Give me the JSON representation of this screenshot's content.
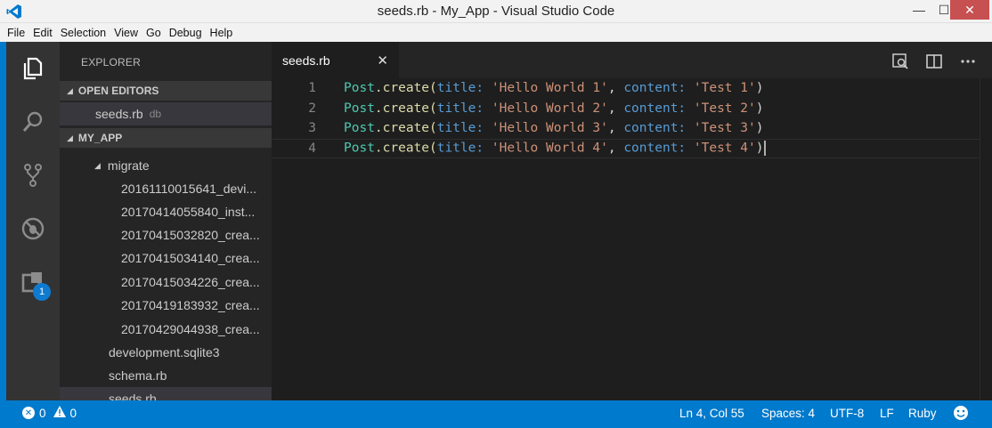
{
  "window": {
    "title": "seeds.rb - My_App - Visual Studio Code",
    "min_label": "—",
    "max_label": "☐",
    "close_label": "✕"
  },
  "menu": [
    "File",
    "Edit",
    "Selection",
    "View",
    "Go",
    "Debug",
    "Help"
  ],
  "activity": {
    "icons": [
      "explorer-icon",
      "search-icon",
      "source-control-icon",
      "debug-icon",
      "extensions-icon"
    ],
    "extensions_badge": "1"
  },
  "sidebar": {
    "header": "EXPLORER",
    "open_editors": {
      "title": "OPEN EDITORS",
      "items": [
        {
          "name": "seeds.rb",
          "desc": "db"
        }
      ]
    },
    "project": {
      "title": "MY_APP",
      "folder": "migrate",
      "migrations": [
        "20161110015641_devi...",
        "20170414055840_inst...",
        "20170415032820_crea...",
        "20170415034140_crea...",
        "20170415034226_crea...",
        "20170419183932_crea...",
        "20170429044938_crea..."
      ],
      "files": [
        "development.sqlite3",
        "schema.rb",
        "seeds.rb"
      ]
    }
  },
  "editor": {
    "tab": {
      "label": "seeds.rb",
      "close": "✕"
    },
    "lines": [
      {
        "num": "1",
        "title": "'Hello World 1'",
        "content": "'Test 1'"
      },
      {
        "num": "2",
        "title": "'Hello World 2'",
        "content": "'Test 2'"
      },
      {
        "num": "3",
        "title": "'Hello World 3'",
        "content": "'Test 3'"
      },
      {
        "num": "4",
        "title": "'Hello World 4'",
        "content": "'Test 4'"
      }
    ],
    "tokens": {
      "class": "Post",
      "method": ".create(",
      "key_title": "title:",
      "comma": ",",
      "key_content": "content:",
      "close": ")"
    }
  },
  "status": {
    "errors": "0",
    "warnings": "0",
    "position": "Ln 4, Col 55",
    "spaces": "Spaces: 4",
    "encoding": "UTF-8",
    "eol": "LF",
    "language": "Ruby"
  },
  "colors": {
    "accent": "#007acc",
    "sidebar": "#252526",
    "editor": "#1e1e1e",
    "activitybar": "#333333"
  }
}
